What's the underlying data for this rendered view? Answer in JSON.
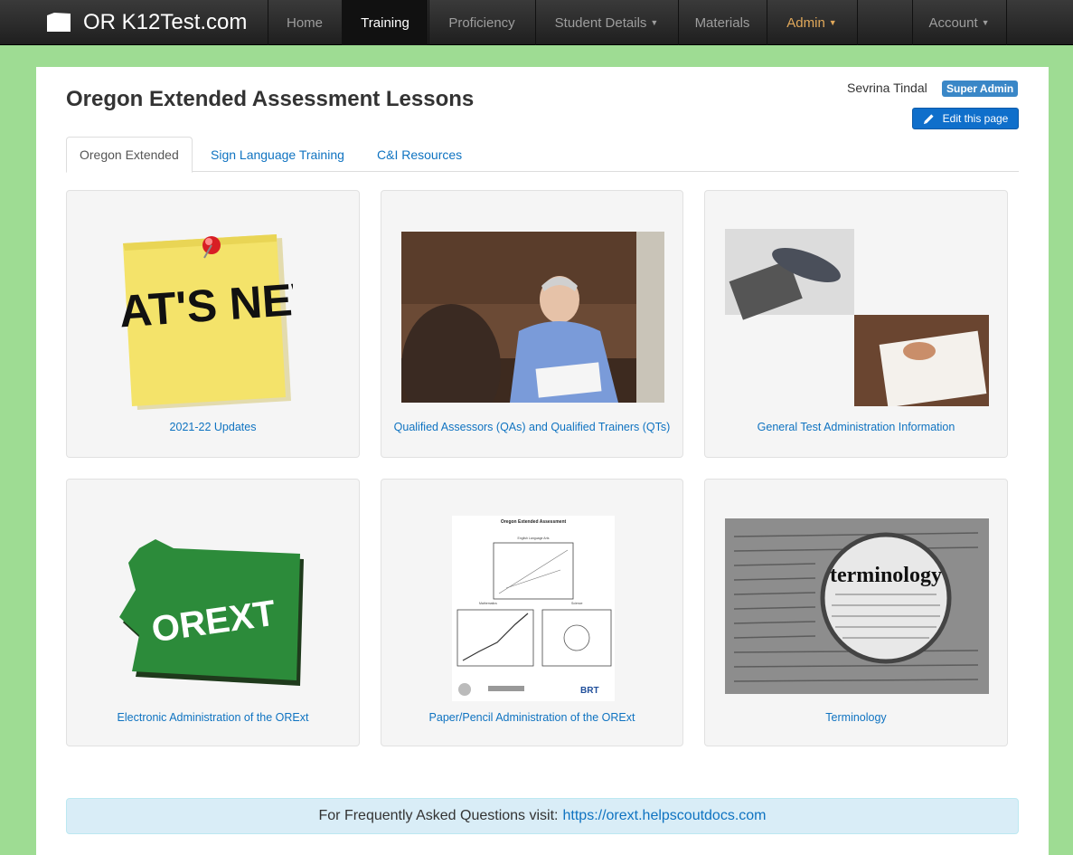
{
  "navbar": {
    "brand": "OR K12Test.com",
    "items": [
      {
        "label": "Home"
      },
      {
        "label": "Training"
      },
      {
        "label": "Proficiency"
      },
      {
        "label": "Student Details"
      },
      {
        "label": "Materials"
      },
      {
        "label": "Admin"
      },
      {
        "label": "Account"
      }
    ]
  },
  "header": {
    "title": "Oregon Extended Assessment Lessons",
    "user_name": "Sevrina Tindal",
    "role": "Super Admin",
    "edit_label": "Edit this page"
  },
  "tabs": [
    {
      "label": "Oregon Extended"
    },
    {
      "label": "Sign Language Training"
    },
    {
      "label": "C&I Resources"
    }
  ],
  "cards": [
    {
      "label": "2021-22 Updates",
      "image_text": "WHAT'S NEW?"
    },
    {
      "label": "Qualified Assessors (QAs) and Qualified Trainers (QTs)"
    },
    {
      "label": "General Test Administration Information"
    },
    {
      "label": "Electronic Administration of the ORExt",
      "image_text": "OREXT"
    },
    {
      "label": "Paper/Pencil Administration of the ORExt",
      "image_text": {
        "heading": "Oregon Extended Assessment",
        "sub1": "English Language Arts",
        "sub2": "Mathematics",
        "sub3": "Science",
        "logo": "BRT"
      }
    },
    {
      "label": "Terminology",
      "image_text": "terminology"
    }
  ],
  "faq": {
    "text": "For Frequently Asked Questions visit:",
    "link": "https://orext.helpscoutdocs.com"
  },
  "colors": {
    "background": "#9edc93",
    "navbar": "#222222",
    "link": "#0f73c1",
    "edit_button": "#0f6fcb",
    "role_badge": "#3a87c7",
    "faq_bg": "#d9edf7"
  }
}
